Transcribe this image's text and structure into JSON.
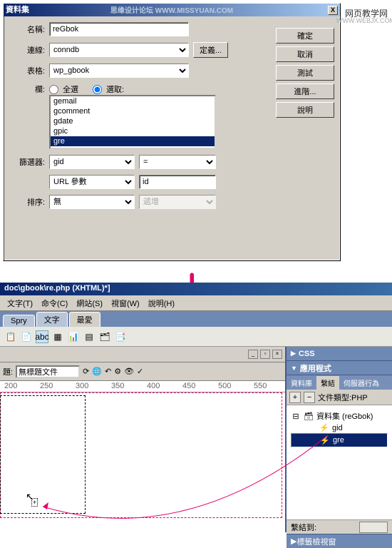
{
  "dialog": {
    "title": "資料集",
    "watermark": "思缘设计论坛 WWW.MISSYUAN.COM",
    "close_label": "X",
    "name_label": "名稱:",
    "name_value": "reGbok",
    "conn_label": "連線:",
    "conn_value": "conndb",
    "define_btn": "定義...",
    "table_label": "表格:",
    "table_value": "wp_gbook",
    "col_label": "欄:",
    "radio_all": "全選",
    "radio_sel": "選取:",
    "list_items": [
      "gemail",
      "gcomment",
      "gdate",
      "gpic",
      "gre"
    ],
    "selected_item": "gre",
    "filter_label": "篩選器:",
    "filter_field": "gid",
    "filter_op": "=",
    "urlparam_label": "URL 參數",
    "urlparam_value": "id",
    "sort_label": "排序:",
    "sort_value": "無",
    "sort_dir": "遞增",
    "buttons": {
      "ok": "確定",
      "cancel": "取消",
      "test": "測試",
      "advanced": "進階...",
      "help": "說明"
    }
  },
  "linkright": "网页教学网",
  "linkright2": "WWW.WEBJX.COM",
  "app": {
    "title": "doc\\gbook\\re.php (XHTML)*]",
    "menu": [
      "文字(T)",
      "命令(C)",
      "網站(S)",
      "視窗(W)",
      "說明(H)"
    ],
    "tabs": {
      "spry": "Spry",
      "text": "文字",
      "fav": "最愛"
    },
    "doc_title_label": "題:",
    "doc_title": "無標題文件",
    "ruler_marks": [
      "200",
      "250",
      "300",
      "350",
      "400",
      "450",
      "500",
      "550"
    ],
    "panels": {
      "css": "CSS",
      "app": "應用程式",
      "tab_db": "資料庫",
      "tab_bind": "繫結",
      "tab_server": "伺服器行為",
      "doctype_label": "文件類型:PHP",
      "recordset": "資料集 (reGbok)",
      "fields": [
        "gid",
        "gre"
      ],
      "selected_field": "gre",
      "bindto": "繫結到:",
      "tagview": "標籤檢視窗"
    }
  }
}
